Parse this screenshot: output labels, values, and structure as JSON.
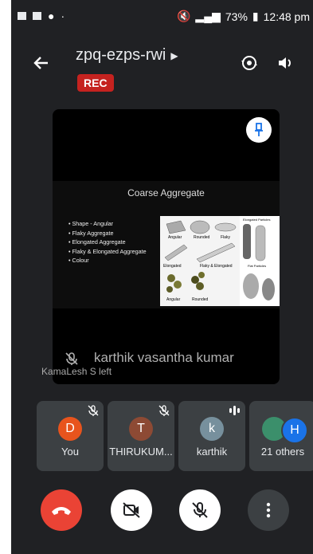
{
  "status_bar": {
    "battery": "73%",
    "time": "12:48 pm"
  },
  "header": {
    "meeting_id": "zpq-ezps-rwi",
    "rec_badge": "REC"
  },
  "slide": {
    "title": "Coarse Aggregate",
    "bullets": [
      "Shape - Angular",
      "Flaky Aggregate",
      "Elongated Aggregate",
      "Flaky & Elongated Aggregate",
      "Colour"
    ],
    "image_labels": [
      "Angular",
      "Rounded",
      "Flaky",
      "Elongated",
      "Flaky & Elongated",
      "Angular",
      "Rounded",
      "Elongated Particles",
      "Flat Particles"
    ]
  },
  "speaker": {
    "name": "karthik vasantha kumar"
  },
  "toast": "KamaLesh S left",
  "participants": [
    {
      "name": "You",
      "initial": "D",
      "color": "#e8541d",
      "muted": true
    },
    {
      "name": "THIRUKUM...",
      "initial": "T",
      "color": "#8d4a34",
      "muted": true
    },
    {
      "name": "karthik",
      "initial": "k",
      "color": "#77909d",
      "speaking": true
    },
    {
      "name": "21 others",
      "initial": "H",
      "color": "#1a73e8"
    }
  ],
  "colors": {
    "end_call": "#ea4335",
    "background": "#202124",
    "tile": "#3c4043"
  },
  "icons": [
    "back-arrow-icon",
    "flip-camera-icon",
    "speaker-icon",
    "pin-icon",
    "mic-off-icon",
    "video-off-icon",
    "end-call-icon",
    "more-icon"
  ]
}
